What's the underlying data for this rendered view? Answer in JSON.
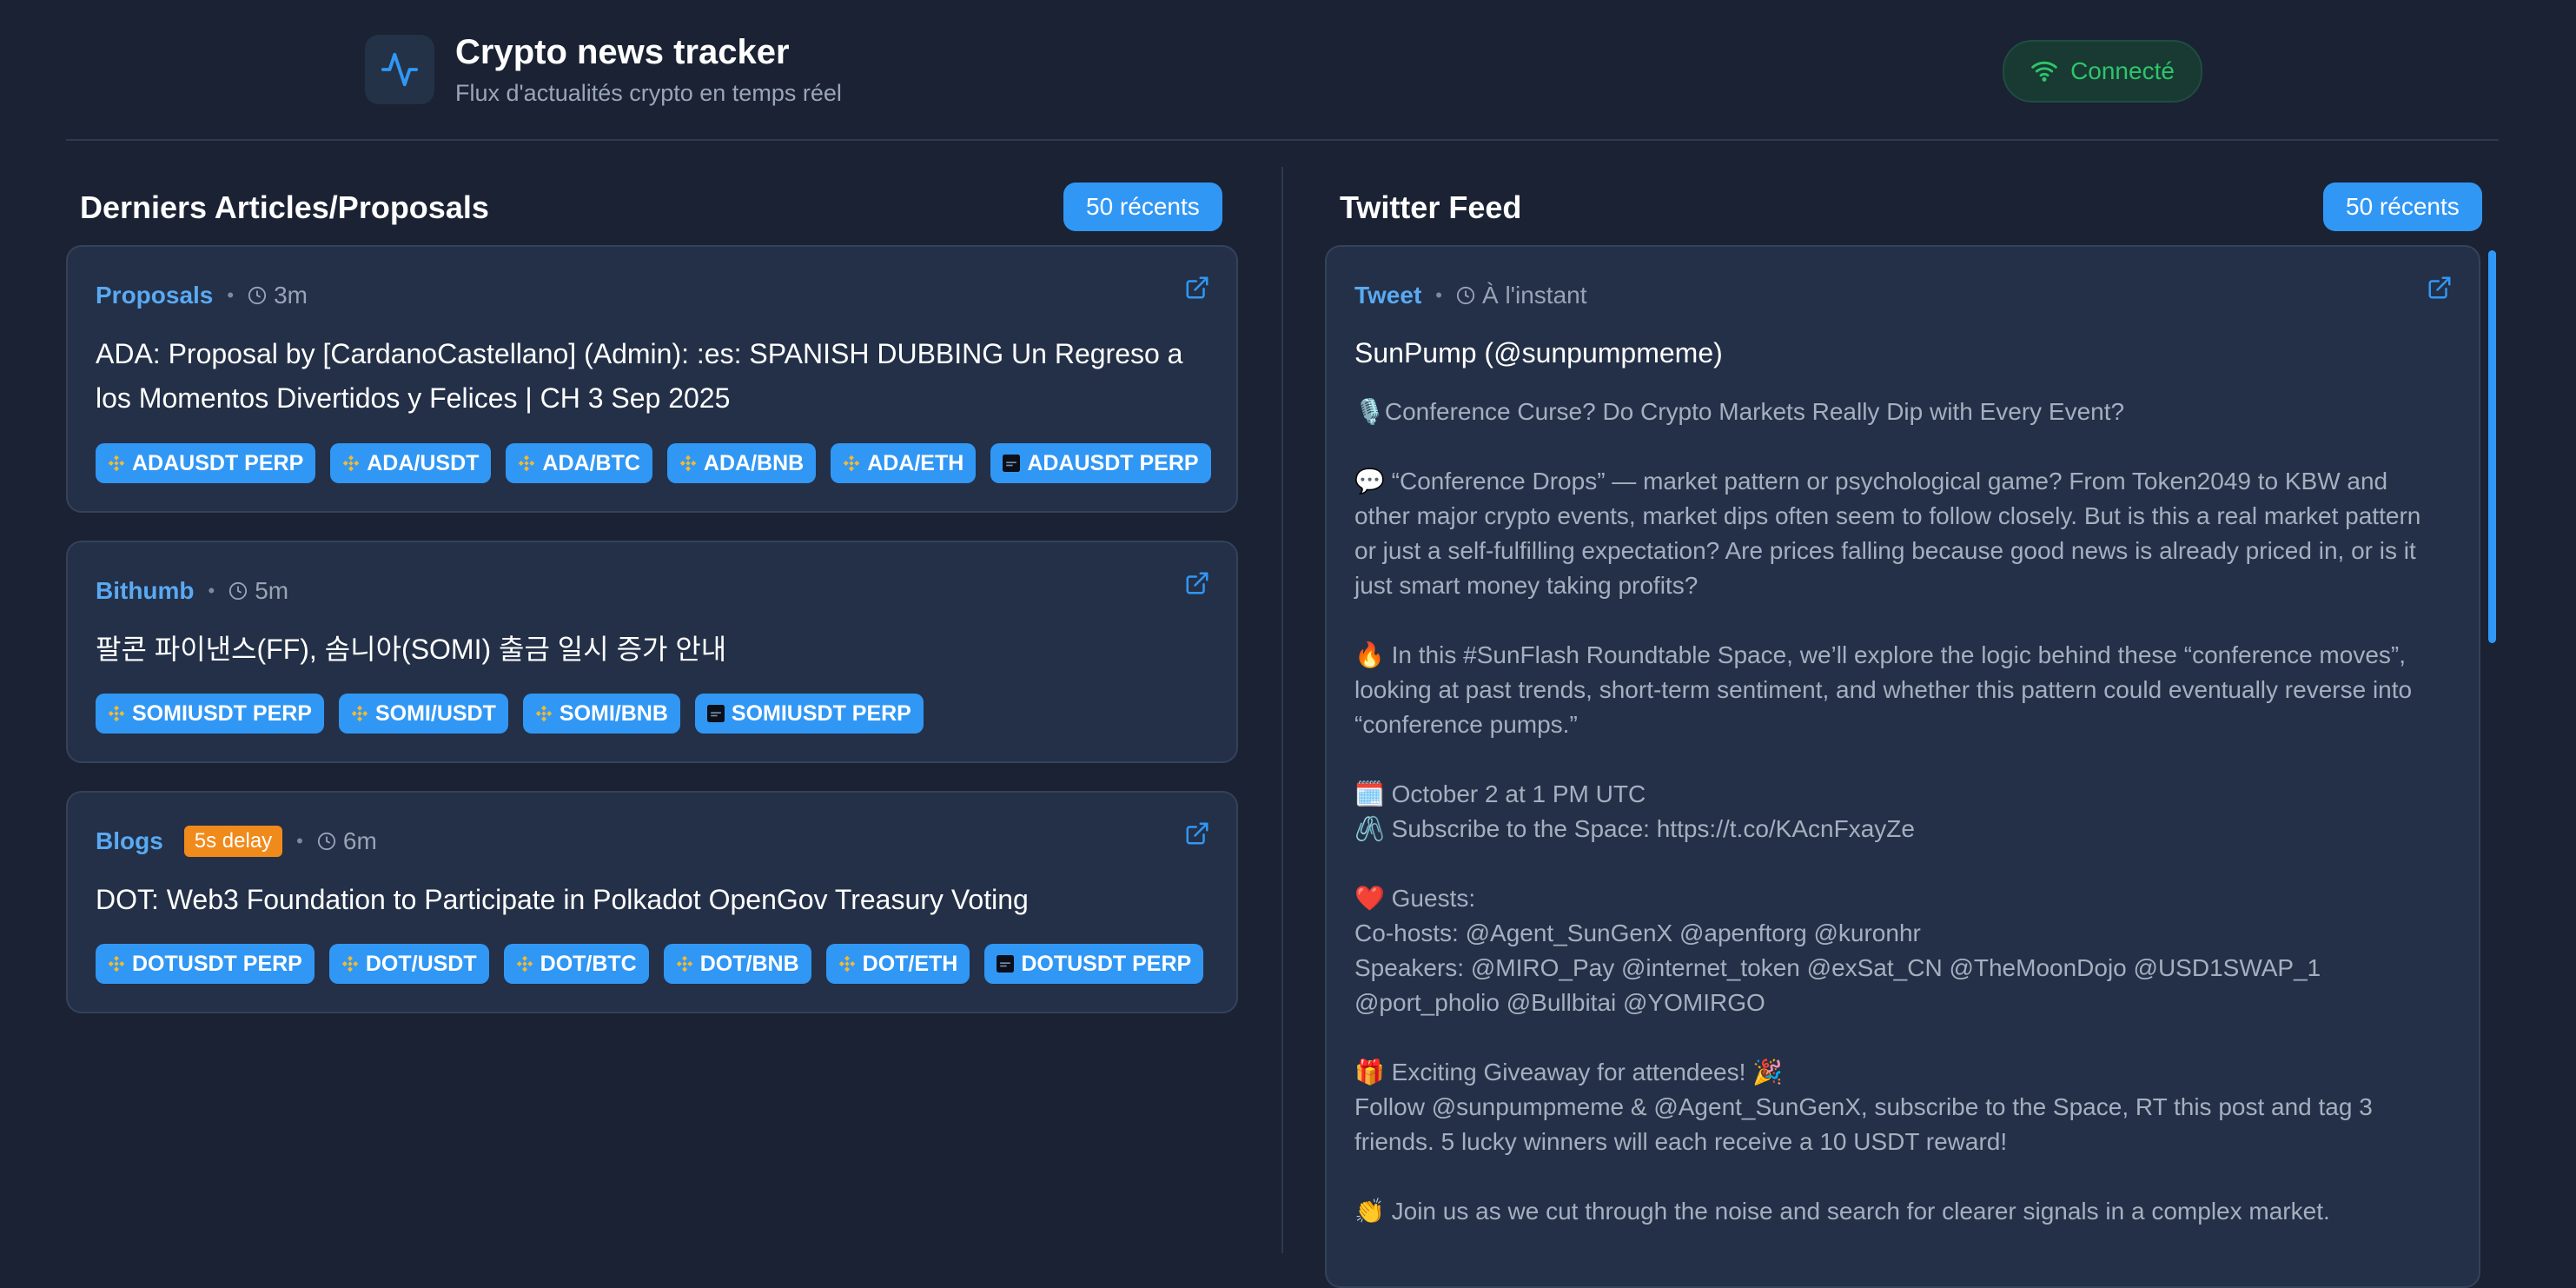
{
  "header": {
    "title": "Crypto news tracker",
    "subtitle": "Flux d'actualités crypto en temps réel",
    "status": "Connecté",
    "colors": {
      "accent": "#3197f5",
      "status": "#2fc46b",
      "background": "#1a2233"
    }
  },
  "articles_column": {
    "title": "Derniers Articles/Proposals",
    "count_label": "50 récents",
    "cards": [
      {
        "source": "Proposals",
        "time": "3m",
        "title": "ADA: Proposal by [CardanoCastellano] (Admin): :es: SPANISH DUBBING Un Regreso a los Momentos Divertidos y Felices | CH 3 Sep 2025",
        "tags": [
          {
            "label": "ADAUSDT PERP",
            "icon": "binance-icon"
          },
          {
            "label": "ADA/USDT",
            "icon": "binance-icon"
          },
          {
            "label": "ADA/BTC",
            "icon": "binance-icon"
          },
          {
            "label": "ADA/BNB",
            "icon": "binance-icon"
          },
          {
            "label": "ADA/ETH",
            "icon": "binance-icon"
          },
          {
            "label": "ADAUSDT PERP",
            "icon": "exchange-logo-icon"
          }
        ]
      },
      {
        "source": "Bithumb",
        "time": "5m",
        "title": "팔콘 파이낸스(FF), 솜니아(SOMI) 출금 일시 증가 안내",
        "tags": [
          {
            "label": "SOMIUSDT PERP",
            "icon": "binance-icon"
          },
          {
            "label": "SOMI/USDT",
            "icon": "binance-icon"
          },
          {
            "label": "SOMI/BNB",
            "icon": "binance-icon"
          },
          {
            "label": "SOMIUSDT PERP",
            "icon": "exchange-logo-icon"
          }
        ]
      },
      {
        "source": "Blogs",
        "delay": "5s delay",
        "time": "6m",
        "title": "DOT: Web3 Foundation to Participate in Polkadot OpenGov Treasury Voting",
        "tags": [
          {
            "label": "DOTUSDT PERP",
            "icon": "binance-icon"
          },
          {
            "label": "DOT/USDT",
            "icon": "binance-icon"
          },
          {
            "label": "DOT/BTC",
            "icon": "binance-icon"
          },
          {
            "label": "DOT/BNB",
            "icon": "binance-icon"
          },
          {
            "label": "DOT/ETH",
            "icon": "binance-icon"
          },
          {
            "label": "DOTUSDT PERP",
            "icon": "exchange-logo-icon"
          }
        ]
      }
    ]
  },
  "twitter_column": {
    "title": "Twitter Feed",
    "count_label": "50 récents",
    "tweet": {
      "source": "Tweet",
      "time": "À l'instant",
      "author": "SunPump (@sunpumpmeme)",
      "body": "🎙️Conference Curse? Do Crypto Markets Really Dip with Every Event?\n\n💬 “Conference Drops” — market pattern or psychological game? From Token2049 to KBW and other major crypto events, market dips often seem to follow closely. But is this a real market pattern or just a self-fulfilling expectation? Are prices falling because good news is already priced in, or is it just smart money taking profits?\n\n🔥 In this #SunFlash Roundtable Space, we’ll explore the logic behind these “conference moves”, looking at past trends, short-term sentiment, and whether this pattern could eventually reverse into “conference pumps.”\n\n🗓️ October 2 at 1 PM UTC\n🖇️ Subscribe to the Space: https://t.co/KAcnFxayZe\n\n❤️ Guests:\nCo-hosts: @Agent_SunGenX @apenftorg @kuronhr\nSpeakers: @MIRO_Pay @internet_token @exSat_CN @TheMoonDojo @USD1SWAP_1 @port_pholio @Bullbitai @YOMIRGO\n\n🎁 Exciting Giveaway for attendees! 🎉\nFollow @sunpumpmeme & @Agent_SunGenX, subscribe to the Space, RT this post and tag 3 friends. 5 lucky winners will each receive a 10 USDT reward!\n\n👏 Join us as we cut through the noise and search for clearer signals in a complex market."
    }
  }
}
